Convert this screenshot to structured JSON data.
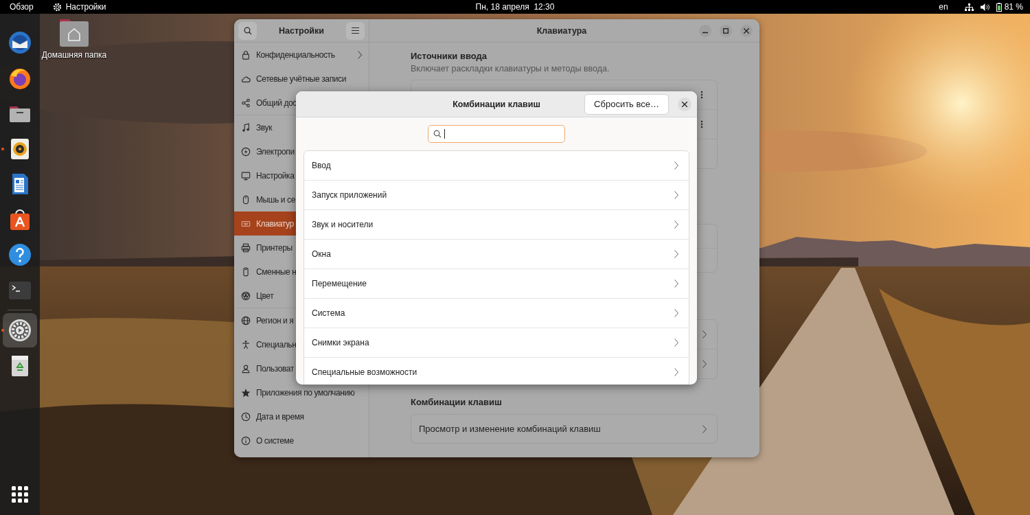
{
  "top_bar": {
    "activities": "Обзор",
    "app_menu": "Настройки",
    "clock": "Пн, 18 апреля  12:30",
    "keyboard_layout": "en",
    "battery": "81 %"
  },
  "dock": {
    "apps": [
      {
        "kind": "mail",
        "running": false,
        "focused": false
      },
      {
        "kind": "browser",
        "running": false,
        "focused": false
      },
      {
        "kind": "files",
        "running": false,
        "focused": false
      },
      {
        "kind": "music",
        "running": true,
        "focused": false
      },
      {
        "kind": "writer",
        "running": false,
        "focused": false
      },
      {
        "kind": "store",
        "running": false,
        "focused": false
      },
      {
        "kind": "help",
        "running": false,
        "focused": false
      },
      {
        "kind": "terminal",
        "running": false,
        "focused": false
      }
    ],
    "after_separator": [
      {
        "kind": "settings",
        "running": true,
        "focused": true
      },
      {
        "kind": "trash",
        "running": false,
        "focused": false
      }
    ]
  },
  "desktop_icons": [
    {
      "label": "Домашняя папка"
    }
  ],
  "settings_window": {
    "title": "Настройки",
    "page_title": "Клавиатура",
    "sidebar": [
      {
        "items": [
          {
            "kind": "lock",
            "label": "Конфиденциальность",
            "has_submenu": true,
            "selected": false
          },
          {
            "kind": "cloud",
            "label": "Сетевые учётные записи",
            "has_submenu": false,
            "selected": false
          },
          {
            "kind": "share",
            "label": "Общий дос",
            "has_submenu": false,
            "selected": false
          }
        ]
      },
      {
        "items": [
          {
            "kind": "music",
            "label": "Звук",
            "has_submenu": false,
            "selected": false
          },
          {
            "kind": "power",
            "label": "Электропи",
            "has_submenu": false,
            "selected": false
          },
          {
            "kind": "display",
            "label": "Настройка",
            "has_submenu": false,
            "selected": false
          },
          {
            "kind": "mouse",
            "label": "Мышь и се",
            "has_submenu": false,
            "selected": false
          },
          {
            "kind": "keyboard",
            "label": "Клавиатур",
            "has_submenu": false,
            "selected": true
          },
          {
            "kind": "printer",
            "label": "Принтеры",
            "has_submenu": false,
            "selected": false
          },
          {
            "kind": "drive",
            "label": "Сменные н",
            "has_submenu": false,
            "selected": false
          },
          {
            "kind": "color",
            "label": "Цвет",
            "has_submenu": false,
            "selected": false
          }
        ]
      },
      {
        "items": [
          {
            "kind": "globe",
            "label": "Регион и я",
            "has_submenu": false,
            "selected": false
          },
          {
            "kind": "accessibility",
            "label": "Специальн",
            "has_submenu": false,
            "selected": false
          },
          {
            "kind": "users",
            "label": "Пользоват",
            "has_submenu": false,
            "selected": false
          },
          {
            "kind": "star",
            "label": "Приложения по умолчанию",
            "has_submenu": false,
            "selected": false
          },
          {
            "kind": "clock",
            "label": "Дата и время",
            "has_submenu": false,
            "selected": false
          },
          {
            "kind": "info",
            "label": "О системе",
            "has_submenu": false,
            "selected": false
          }
        ]
      }
    ],
    "input_sources": {
      "heading": "Источники ввода",
      "description": "Включает раскладки клавиатуры и методы ввода.",
      "rows": [
        {
          "kind": "source"
        },
        {
          "kind": "source"
        },
        {
          "kind": "add"
        }
      ]
    },
    "cards": [
      {
        "rows": [
          {
            "kind": "plain"
          },
          {
            "kind": "plain"
          }
        ]
      },
      {
        "rows": [
          {
            "kind": "link"
          },
          {
            "kind": "link"
          }
        ]
      }
    ],
    "shortcuts": {
      "heading": "Комбинации клавиш",
      "row": "Просмотр и изменение комбинаций клавиш"
    }
  },
  "dialog": {
    "title": "Комбинации клавиш",
    "reset_button": "Сбросить все…",
    "categories": [
      "Ввод",
      "Запуск приложений",
      "Звук и носители",
      "Окна",
      "Перемещение",
      "Система",
      "Снимки экрана",
      "Специальные возможности"
    ]
  }
}
